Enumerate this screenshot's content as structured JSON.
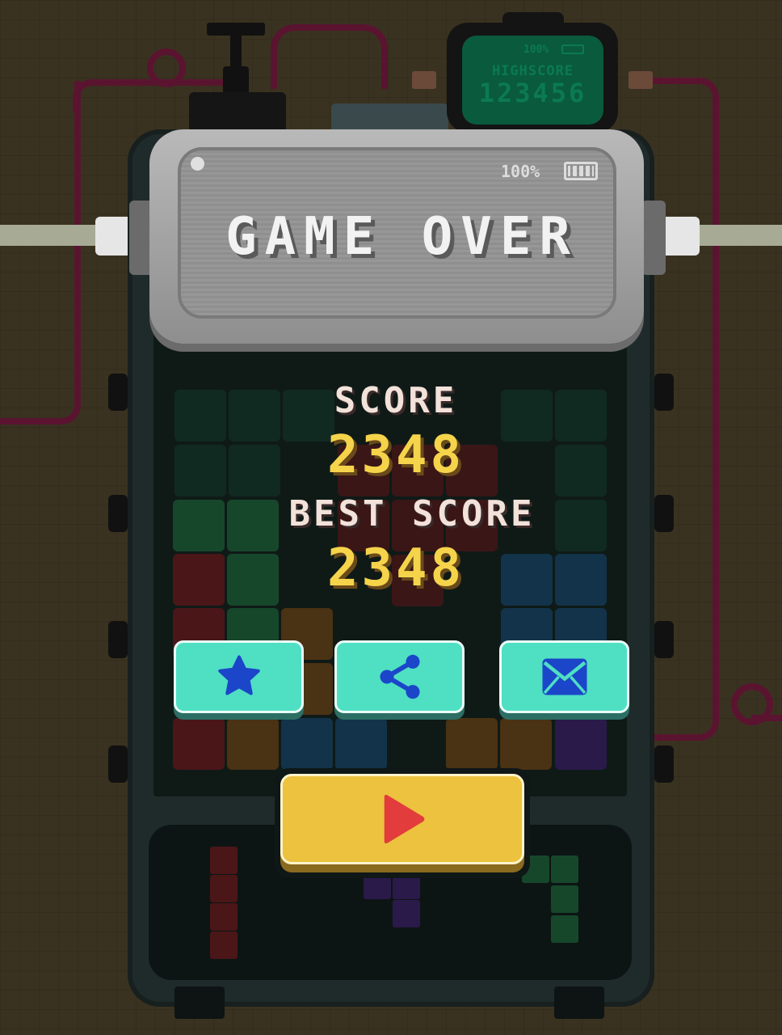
{
  "title": "GAME OVER",
  "battery": {
    "text": "100%"
  },
  "highscore_display": {
    "battery_text": "100%",
    "label": "HIGHSCORE",
    "value": "123456"
  },
  "results": {
    "score_label": "SCORE",
    "score_value": "2348",
    "best_label": "BEST SCORE",
    "best_value": "2348"
  },
  "buttons": {
    "rate": {
      "icon": "star-icon"
    },
    "share": {
      "icon": "share-icon"
    },
    "mail": {
      "icon": "mail-icon"
    },
    "play": {
      "icon": "play-icon"
    }
  },
  "colors": {
    "accent_button": "#4fdfc3",
    "play_button": "#ecc23e",
    "play_icon": "#e23c3c",
    "icon_blue": "#1b46c9",
    "title_text": "#f2f2f2",
    "label_text": "#f3e2da",
    "value_text": "#f5d44b"
  }
}
